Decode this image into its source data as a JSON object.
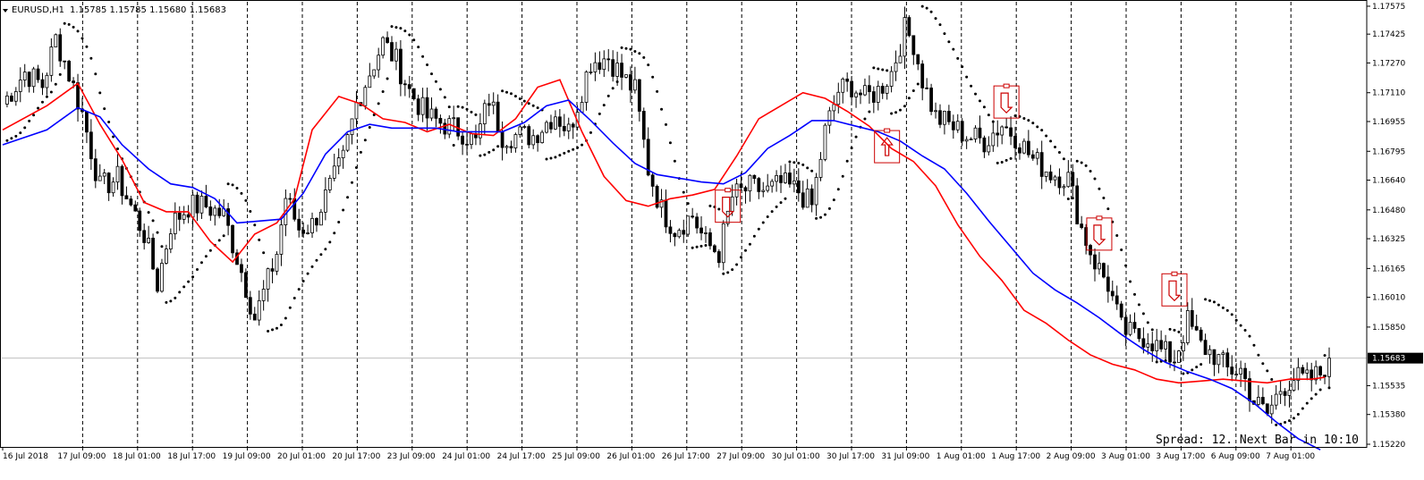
{
  "header": {
    "symbol_label": "EURUSD,H1",
    "ohlc": "1.15785 1.15785 1.15680 1.15683"
  },
  "footer": {
    "status_text": "Spread: 12. Next Bar in 10:10"
  },
  "colors": {
    "background": "#ffffff",
    "bull_candle": "#ffffff",
    "bear_candle": "#000000",
    "candle_outline": "#000000",
    "ma_fast": "#ff0000",
    "ma_slow": "#0000ff",
    "parabolic_sar": "#000000",
    "signal_marker": "#cc0000",
    "price_line": "#c0c0c0",
    "current_price_bg": "#000000",
    "current_price_text": "#ffffff"
  },
  "chart_data": {
    "type": "candlestick",
    "symbol": "EURUSD",
    "timeframe": "H1",
    "ylim": [
      1.1522,
      1.1757
    ],
    "y_ticks": [
      "1.17575",
      "1.17425",
      "1.17270",
      "1.17110",
      "1.16955",
      "1.16795",
      "1.16640",
      "1.16480",
      "1.16325",
      "1.16165",
      "1.16010",
      "1.15850",
      "1.15683",
      "1.15535",
      "1.15380",
      "1.15220"
    ],
    "current_price": "1.15683",
    "x_ticks": [
      "16 Jul 2018",
      "17 Jul 09:00",
      "18 Jul 01:00",
      "18 Jul 17:00",
      "19 Jul 09:00",
      "20 Jul 01:00",
      "20 Jul 17:00",
      "23 Jul 09:00",
      "24 Jul 01:00",
      "24 Jul 17:00",
      "25 Jul 09:00",
      "26 Jul 01:00",
      "26 Jul 17:00",
      "27 Jul 09:00",
      "30 Jul 01:00",
      "30 Jul 17:00",
      "31 Jul 09:00",
      "1 Aug 01:00",
      "1 Aug 17:00",
      "2 Aug 09:00",
      "3 Aug 01:00",
      "3 Aug 17:00",
      "6 Aug 09:00",
      "7 Aug 01:00"
    ],
    "price_path": [
      [
        0,
        1.1705
      ],
      [
        5,
        1.1722
      ],
      [
        9,
        1.1715
      ],
      [
        12,
        1.174
      ],
      [
        14,
        1.1728
      ],
      [
        18,
        1.17
      ],
      [
        22,
        1.166
      ],
      [
        26,
        1.1665
      ],
      [
        32,
        1.1635
      ],
      [
        35,
        1.1608
      ],
      [
        38,
        1.164
      ],
      [
        42,
        1.165
      ],
      [
        46,
        1.165
      ],
      [
        50,
        1.1645
      ],
      [
        54,
        1.1615
      ],
      [
        57,
        1.159
      ],
      [
        60,
        1.161
      ],
      [
        62,
        1.1625
      ],
      [
        64,
        1.1655
      ],
      [
        67,
        1.1638
      ],
      [
        70,
        1.164
      ],
      [
        74,
        1.166
      ],
      [
        77,
        1.1675
      ],
      [
        80,
        1.1705
      ],
      [
        83,
        1.1722
      ],
      [
        86,
        1.1738
      ],
      [
        89,
        1.1728
      ],
      [
        92,
        1.1712
      ],
      [
        96,
        1.1698
      ],
      [
        100,
        1.1694
      ],
      [
        104,
        1.169
      ],
      [
        107,
        1.1684
      ],
      [
        110,
        1.1708
      ],
      [
        113,
        1.1688
      ],
      [
        116,
        1.1688
      ],
      [
        120,
        1.1688
      ],
      [
        125,
        1.17
      ],
      [
        128,
        1.169
      ],
      [
        133,
        1.1728
      ],
      [
        137,
        1.173
      ],
      [
        140,
        1.172
      ],
      [
        143,
        1.1712
      ],
      [
        146,
        1.167
      ],
      [
        149,
        1.1648
      ],
      [
        152,
        1.1638
      ],
      [
        156,
        1.1645
      ],
      [
        159,
        1.163
      ],
      [
        162,
        1.1625
      ],
      [
        165,
        1.1655
      ],
      [
        169,
        1.166
      ],
      [
        173,
        1.1658
      ],
      [
        176,
        1.1662
      ],
      [
        180,
        1.1658
      ],
      [
        183,
        1.165
      ],
      [
        186,
        1.169
      ],
      [
        189,
        1.1712
      ],
      [
        192,
        1.1715
      ],
      [
        195,
        1.1708
      ],
      [
        198,
        1.1712
      ],
      [
        201,
        1.1722
      ],
      [
        204,
        1.1745
      ],
      [
        206,
        1.1738
      ],
      [
        208,
        1.1718
      ],
      [
        211,
        1.1698
      ],
      [
        214,
        1.1694
      ],
      [
        218,
        1.1688
      ],
      [
        222,
        1.1685
      ],
      [
        226,
        1.1694
      ],
      [
        229,
        1.1688
      ],
      [
        233,
        1.1675
      ],
      [
        237,
        1.1668
      ],
      [
        241,
        1.1665
      ],
      [
        244,
        1.1638
      ],
      [
        247,
        1.162
      ],
      [
        250,
        1.1608
      ],
      [
        253,
        1.1584
      ],
      [
        256,
        1.158
      ],
      [
        259,
        1.158
      ],
      [
        262,
        1.1572
      ],
      [
        265,
        1.1568
      ],
      [
        268,
        1.1588
      ],
      [
        271,
        1.1575
      ],
      [
        274,
        1.157
      ],
      [
        277,
        1.1562
      ],
      [
        280,
        1.1562
      ],
      [
        283,
        1.1545
      ],
      [
        286,
        1.1538
      ],
      [
        289,
        1.1552
      ],
      [
        292,
        1.1558
      ],
      [
        295,
        1.1556
      ],
      [
        298,
        1.156
      ],
      [
        300,
        1.15683
      ]
    ],
    "series": [
      {
        "name": "MA fast",
        "color": "#ff0000",
        "x": [
          0,
          10,
          17,
          22,
          27,
          32,
          37,
          42,
          47,
          52,
          57,
          62,
          66,
          70,
          76,
          81,
          86,
          91,
          96,
          101,
          106,
          111,
          116,
          121,
          126,
          131,
          136,
          141,
          146,
          151,
          156,
          161,
          166,
          171,
          176,
          181,
          186,
          191,
          196,
          201,
          206,
          211,
          216,
          221,
          226,
          231,
          236,
          241,
          246,
          251,
          256,
          261,
          266,
          271,
          276,
          281,
          286,
          291,
          296,
          299
        ],
        "y": [
          1.1691,
          1.1704,
          1.1716,
          1.1694,
          1.1675,
          1.1652,
          1.1647,
          1.1647,
          1.1631,
          1.162,
          1.1635,
          1.1641,
          1.1654,
          1.1691,
          1.1709,
          1.1705,
          1.1697,
          1.1695,
          1.169,
          1.1694,
          1.1689,
          1.1688,
          1.1697,
          1.1714,
          1.1718,
          1.169,
          1.1666,
          1.1653,
          1.165,
          1.1654,
          1.1656,
          1.1659,
          1.1677,
          1.1697,
          1.1704,
          1.1711,
          1.1708,
          1.1701,
          1.1693,
          1.1681,
          1.1674,
          1.1661,
          1.164,
          1.1623,
          1.161,
          1.1594,
          1.1587,
          1.1578,
          1.157,
          1.1565,
          1.1562,
          1.1557,
          1.1555,
          1.1556,
          1.1557,
          1.1556,
          1.1555,
          1.1557,
          1.1557,
          1.1558
        ]
      },
      {
        "name": "MA slow",
        "color": "#0000ff",
        "x": [
          0,
          10,
          17,
          22,
          27,
          33,
          38,
          43,
          48,
          53,
          58,
          63,
          68,
          73,
          78,
          83,
          88,
          93,
          98,
          103,
          108,
          113,
          118,
          123,
          128,
          133,
          138,
          143,
          148,
          153,
          158,
          163,
          168,
          173,
          178,
          183,
          188,
          193,
          198,
          203,
          208,
          213,
          218,
          223,
          228,
          233,
          238,
          243,
          248,
          253,
          258,
          263,
          268,
          273,
          278,
          283,
          288,
          293,
          298
        ],
        "y": [
          1.1683,
          1.1691,
          1.1703,
          1.1698,
          1.1683,
          1.167,
          1.1662,
          1.166,
          1.1654,
          1.1641,
          1.1642,
          1.1643,
          1.1657,
          1.1678,
          1.169,
          1.1694,
          1.1692,
          1.1692,
          1.1692,
          1.169,
          1.169,
          1.169,
          1.1695,
          1.1704,
          1.1707,
          1.1696,
          1.1684,
          1.1673,
          1.1667,
          1.1665,
          1.1663,
          1.1662,
          1.1668,
          1.1681,
          1.1688,
          1.1696,
          1.1696,
          1.1693,
          1.169,
          1.1685,
          1.1677,
          1.167,
          1.1657,
          1.1642,
          1.1628,
          1.1614,
          1.1605,
          1.1598,
          1.159,
          1.1581,
          1.1573,
          1.1566,
          1.1561,
          1.1557,
          1.1552,
          1.1544,
          1.1534,
          1.1525,
          1.1519
        ]
      }
    ],
    "signals": [
      {
        "x": 164,
        "y": 1.165,
        "direction": "down"
      },
      {
        "x": 200,
        "y": 1.1682,
        "direction": "up"
      },
      {
        "x": 227,
        "y": 1.1706,
        "direction": "down"
      },
      {
        "x": 248,
        "y": 1.1635,
        "direction": "down"
      },
      {
        "x": 265,
        "y": 1.1605,
        "direction": "down"
      }
    ],
    "grid": "vertical dashed",
    "legend": "none"
  }
}
